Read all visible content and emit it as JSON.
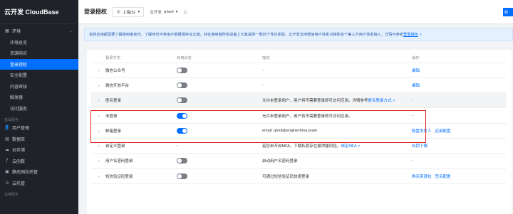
{
  "sidebar": {
    "brand": "云开发 CloudBase",
    "items": [
      {
        "label": "环境",
        "icon": "env-icon",
        "expand": "chevron-up"
      },
      {
        "label": "环境总览"
      },
      {
        "label": "资源购买"
      },
      {
        "label": "登录授权"
      },
      {
        "label": "安全配置"
      },
      {
        "label": "内容审核"
      },
      {
        "label": "触发器"
      },
      {
        "label": "访问服务"
      }
    ],
    "section_basic": "基础服务",
    "basic_items": [
      {
        "label": "用户管理",
        "icon": "user-icon"
      },
      {
        "label": "数据库",
        "icon": "database-icon"
      },
      {
        "label": "云存储",
        "icon": "storage-icon"
      },
      {
        "label": "云函数",
        "icon": "function-icon"
      },
      {
        "label": "静态网站托管",
        "icon": "hosting-icon"
      },
      {
        "label": "云托管",
        "icon": "cloudrun-icon"
      }
    ],
    "section_ops": "运维服务"
  },
  "topbar": {
    "title": "登录授权",
    "region": "上海(5)",
    "env_label": "云开发",
    "env_value": "q-tool",
    "right_button": "购"
  },
  "notice": {
    "text": "多款应用都需要了解使用者身份，了解身份可将用户数据保存在云端，并在使用者所有设备上为其提供一致的个性化体验。云开发支持微信用户体系对接和多个第三方用户体系接入，详情可参考",
    "link": "登录授权"
  },
  "table": {
    "headers": [
      "登录方式",
      "启用状态",
      "描述",
      "操作"
    ],
    "rows": [
      {
        "method": "微信公众号",
        "enabled": false,
        "desc": "-",
        "ops": [
          "编辑"
        ]
      },
      {
        "method": "微信开放平台",
        "enabled": false,
        "desc": "-",
        "ops": [
          "编辑"
        ]
      },
      {
        "method": "匿名登录",
        "enabled": false,
        "desc": "允许未登录用户，用户将不需要登录即可访问应用。详情参考",
        "desc_link": "匿名登录方式",
        "ops": [
          "-"
        ],
        "shaded": true
      },
      {
        "method": "未登录",
        "enabled": true,
        "desc": "允许未登录用户，用户将不需要登录即可访问应用。",
        "ops": [
          "-"
        ]
      },
      {
        "method": "邮箱登录",
        "enabled": true,
        "desc": "email: qtool@enginechina.team",
        "ops": [
          "配置发件人",
          "应用配置"
        ]
      },
      {
        "method": "自定义登录",
        "enabled": null,
        "status_text": "-",
        "desc": "若您未开启MFA，下载私钥存在被泄露风险。",
        "desc_link": "绑定MFA",
        "ops": [
          "私钥下载"
        ]
      },
      {
        "method": "用户名密码登录",
        "enabled": false,
        "desc": "启动用户名密码登录",
        "ops": [
          "-"
        ]
      },
      {
        "method": "短信验证码登录",
        "enabled": false,
        "desc": "可通过短信验证码快速登录",
        "ops": [
          "购买资源包",
          "签名配置"
        ]
      }
    ]
  },
  "colors": {
    "accent": "#006eff",
    "highlight": "#e02020",
    "sidebar_bg": "#1f2329"
  }
}
